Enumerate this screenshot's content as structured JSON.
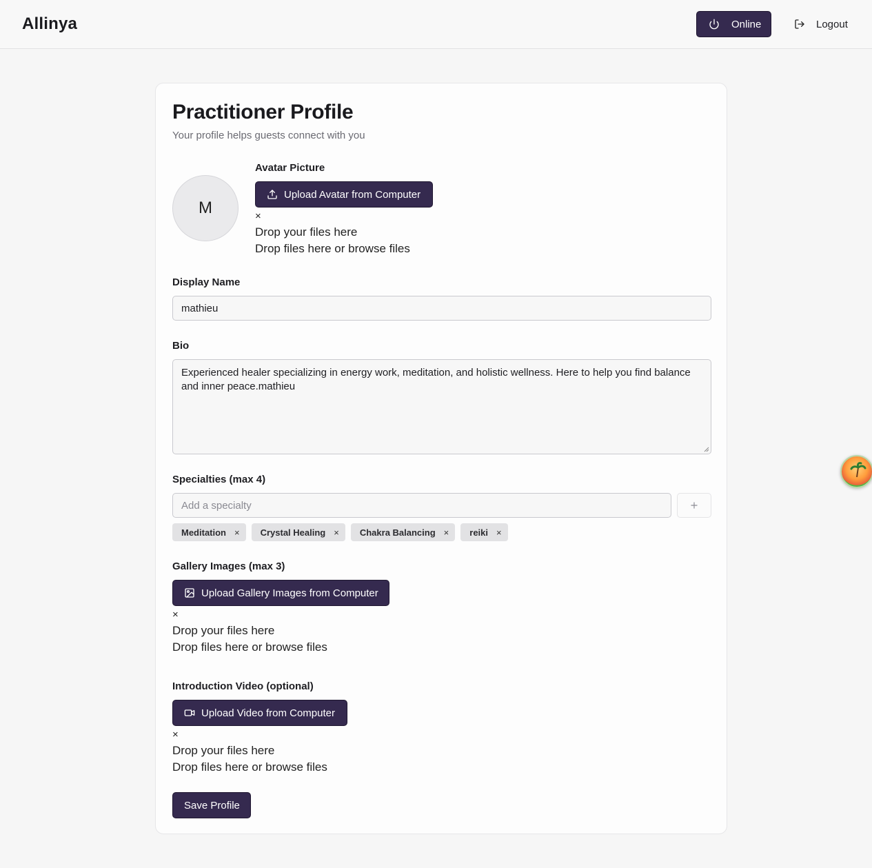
{
  "header": {
    "brand": "Allinya",
    "online_label": "Online",
    "logout_label": "Logout"
  },
  "profile": {
    "title": "Practitioner Profile",
    "subtitle": "Your profile helps guests connect with you",
    "avatar_initial": "M",
    "avatar_label": "Avatar Picture",
    "avatar_upload_label": "Upload Avatar from Computer",
    "close_mark": "×",
    "drop_primary": "Drop your files here",
    "drop_secondary": "Drop files here or browse files",
    "display_name_label": "Display Name",
    "display_name_value": "mathieu",
    "bio_label": "Bio",
    "bio_value": "Experienced healer specializing in energy work, meditation, and holistic wellness. Here to help you find balance and inner peace.mathieu",
    "specialties_label": "Specialties (max 4)",
    "specialty_placeholder": "Add a specialty",
    "specialties": [
      {
        "label": "Meditation"
      },
      {
        "label": "Crystal Healing"
      },
      {
        "label": "Chakra Balancing"
      },
      {
        "label": "reiki"
      }
    ],
    "gallery_label": "Gallery Images (max 3)",
    "gallery_upload_label": "Upload Gallery Images from Computer",
    "video_label": "Introduction Video (optional)",
    "video_upload_label": "Upload Video from Computer",
    "save_label": "Save Profile"
  },
  "icons": {
    "online": "power-icon",
    "logout": "logout-icon",
    "avatar_upload": "upload-icon",
    "gallery_upload": "image-icon",
    "video_upload": "video-icon",
    "add_specialty": "plus-icon",
    "floating": "beach-island-icon"
  },
  "colors": {
    "primary": "#352a4f",
    "background": "#f6f6f6",
    "card": "#fdfdfd",
    "tag": "#e2e2e4"
  }
}
